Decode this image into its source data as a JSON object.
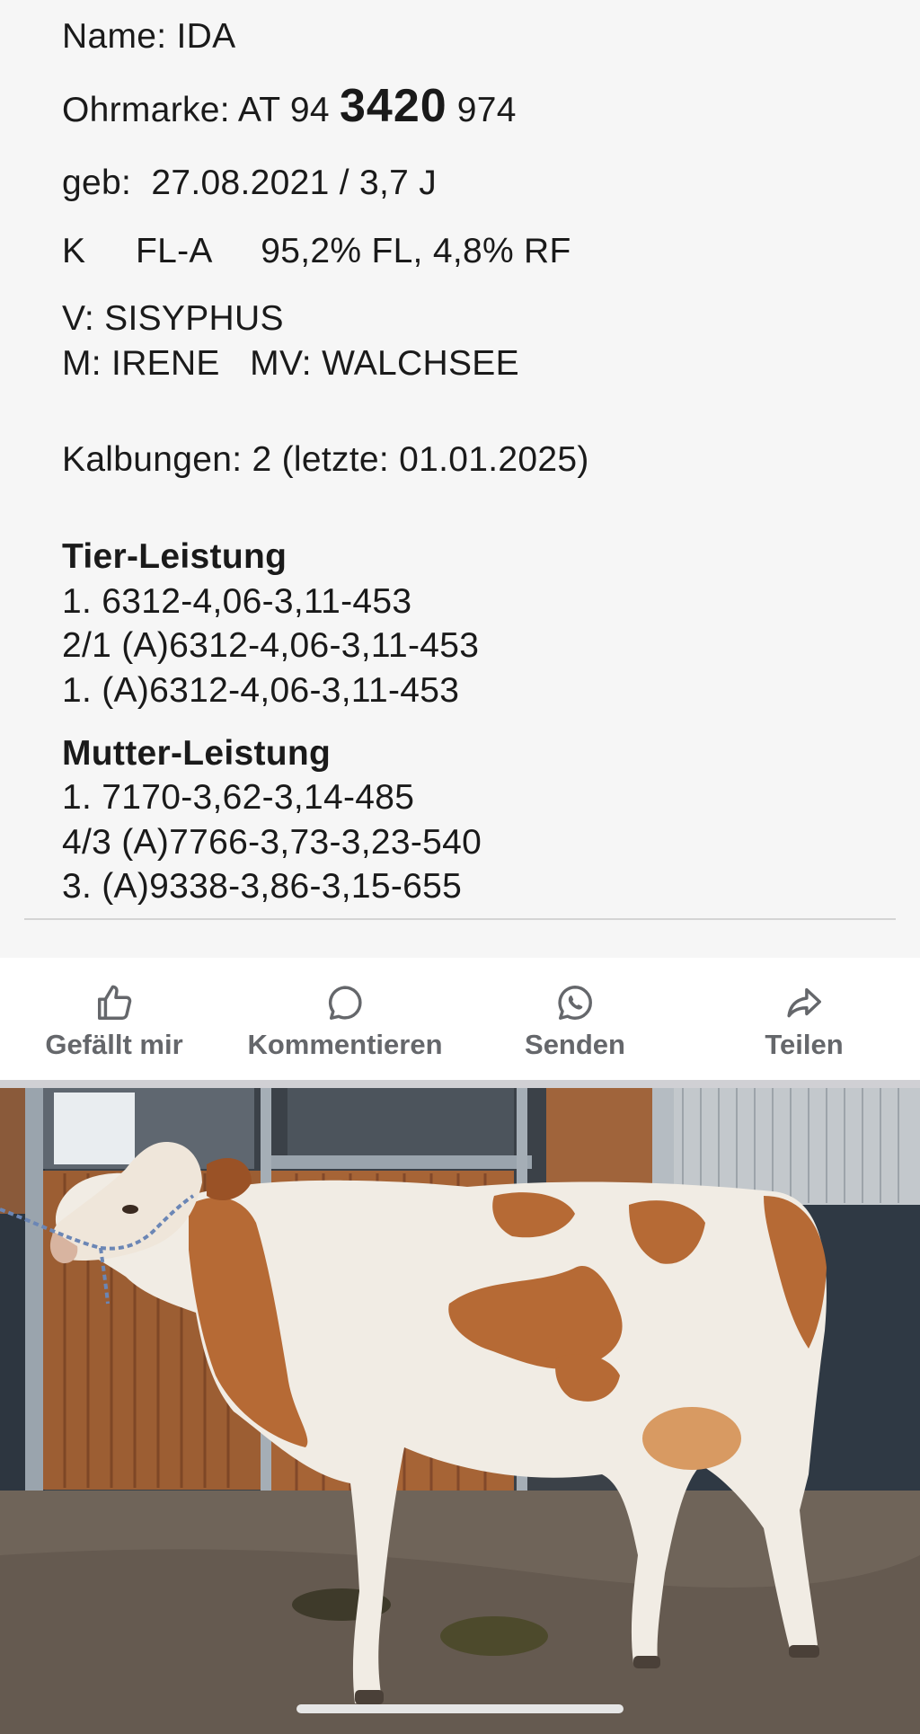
{
  "details": {
    "name_line": "Name: IDA",
    "ear_tag_prefix": "Ohrmarke: AT 94 ",
    "ear_tag_bold": "3420",
    "ear_tag_suffix": " 974",
    "birth_line": "geb:  27.08.2021 / 3,7 J",
    "breed_line": "K     FL-A     95,2% FL, 4,8% RF",
    "sire_line": "V: SISYPHUS",
    "dam_line": "M: IRENE   MV: WALCHSEE",
    "calvings_line": "Kalbungen: 2 (letzte: 01.01.2025)"
  },
  "animal_performance": {
    "heading": "Tier-Leistung",
    "lines": [
      "1. 6312-4,06-3,11-453",
      "2/1 (A)6312-4,06-3,11-453",
      "1. (A)6312-4,06-3,11-453"
    ]
  },
  "dam_performance": {
    "heading": "Mutter-Leistung",
    "lines": [
      "1. 7170-3,62-3,14-485",
      "4/3 (A)7766-3,73-3,23-540",
      "3. (A)9338-3,86-3,15-655"
    ]
  },
  "actions": [
    {
      "label": "Gefällt mir",
      "icon": "thumbs-up-icon"
    },
    {
      "label": "Kommentieren",
      "icon": "comment-icon"
    },
    {
      "label": "Senden",
      "icon": "whatsapp-icon"
    },
    {
      "label": "Teilen",
      "icon": "share-icon"
    }
  ],
  "colors": {
    "action_label": "#65676b",
    "text": "#1a1a1a"
  }
}
